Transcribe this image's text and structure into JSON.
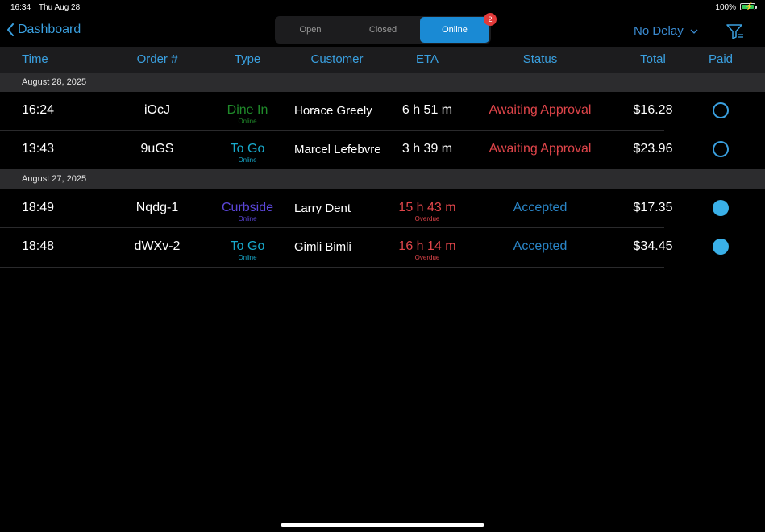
{
  "status_bar": {
    "time": "16:34",
    "date": "Thu Aug 28",
    "battery": "100%"
  },
  "nav": {
    "back_label": "Dashboard",
    "segments": [
      {
        "label": "Open"
      },
      {
        "label": "Closed"
      },
      {
        "label": "Online",
        "badge": "2"
      }
    ],
    "delay": "No Delay"
  },
  "columns": [
    "Time",
    "Order #",
    "Type",
    "Customer",
    "ETA",
    "Status",
    "Total",
    "Paid"
  ],
  "sections": [
    {
      "date": "August 28, 2025",
      "rows": [
        {
          "time": "16:24",
          "order": "iOcJ",
          "type": "Dine In",
          "type_sub": "Online",
          "type_color": "#1f8a2a",
          "customer": "Horace Greely",
          "eta": "6 h 51 m",
          "eta_sub": "",
          "eta_color": "#ffffff",
          "status": "Awaiting Approval",
          "status_color": "#e0454a",
          "total": "$16.28",
          "paid": false
        },
        {
          "time": "13:43",
          "order": "9uGS",
          "type": "To Go",
          "type_sub": "Online",
          "type_color": "#18aacc",
          "customer": "Marcel Lefebvre",
          "eta": "3 h 39 m",
          "eta_sub": "",
          "eta_color": "#ffffff",
          "status": "Awaiting Approval",
          "status_color": "#e0454a",
          "total": "$23.96",
          "paid": false
        }
      ]
    },
    {
      "date": "August 27, 2025",
      "rows": [
        {
          "time": "18:49",
          "order": "Nqdg-1",
          "type": "Curbside",
          "type_sub": "Online",
          "type_color": "#5b46d8",
          "customer": "Larry Dent",
          "eta": "15 h 43 m",
          "eta_sub": "Overdue",
          "eta_color": "#e0454a",
          "status": "Accepted",
          "status_color": "#2a86c8",
          "total": "$17.35",
          "paid": true
        },
        {
          "time": "18:48",
          "order": "dWXv-2",
          "type": "To Go",
          "type_sub": "Online",
          "type_color": "#18aacc",
          "customer": "Gimli Bimli",
          "eta": "16 h 14 m",
          "eta_sub": "Overdue",
          "eta_color": "#e0454a",
          "status": "Accepted",
          "status_color": "#2a86c8",
          "total": "$34.45",
          "paid": true
        }
      ]
    }
  ],
  "colors": {
    "accent": "#3aa0e0",
    "selected_segment": "#1a8ad4"
  }
}
